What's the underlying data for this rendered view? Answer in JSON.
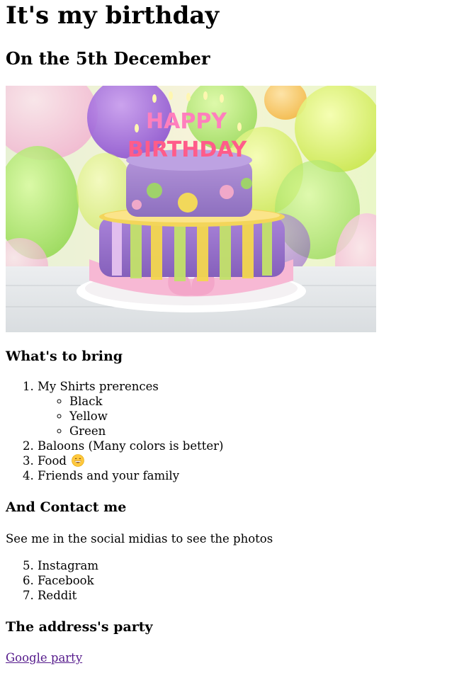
{
  "page": {
    "title": "It's my birthday",
    "subtitle": "On the 5th December"
  },
  "hero_image": {
    "cake_text_top": "HAPPY",
    "cake_text_bottom": "BIRTHDAY"
  },
  "bring": {
    "heading": "What's to bring",
    "items": [
      {
        "label": "My Shirts prerences",
        "sub": [
          "Black",
          "Yellow",
          "Green"
        ]
      },
      {
        "label": "Baloons (Many colors is better)"
      },
      {
        "label": "Food",
        "emoji": "grinning-face-icon"
      },
      {
        "label": "Friends and your family"
      }
    ]
  },
  "contact": {
    "heading": "And Contact me",
    "text": "See me in the social midias to see the photos",
    "start": 5,
    "items": [
      "Instagram",
      "Facebook",
      "Reddit"
    ]
  },
  "address": {
    "heading": "The address's party",
    "link_label": "Google party"
  },
  "colors": {
    "link": "#551a8b",
    "text": "#000000",
    "background": "#ffffff"
  }
}
